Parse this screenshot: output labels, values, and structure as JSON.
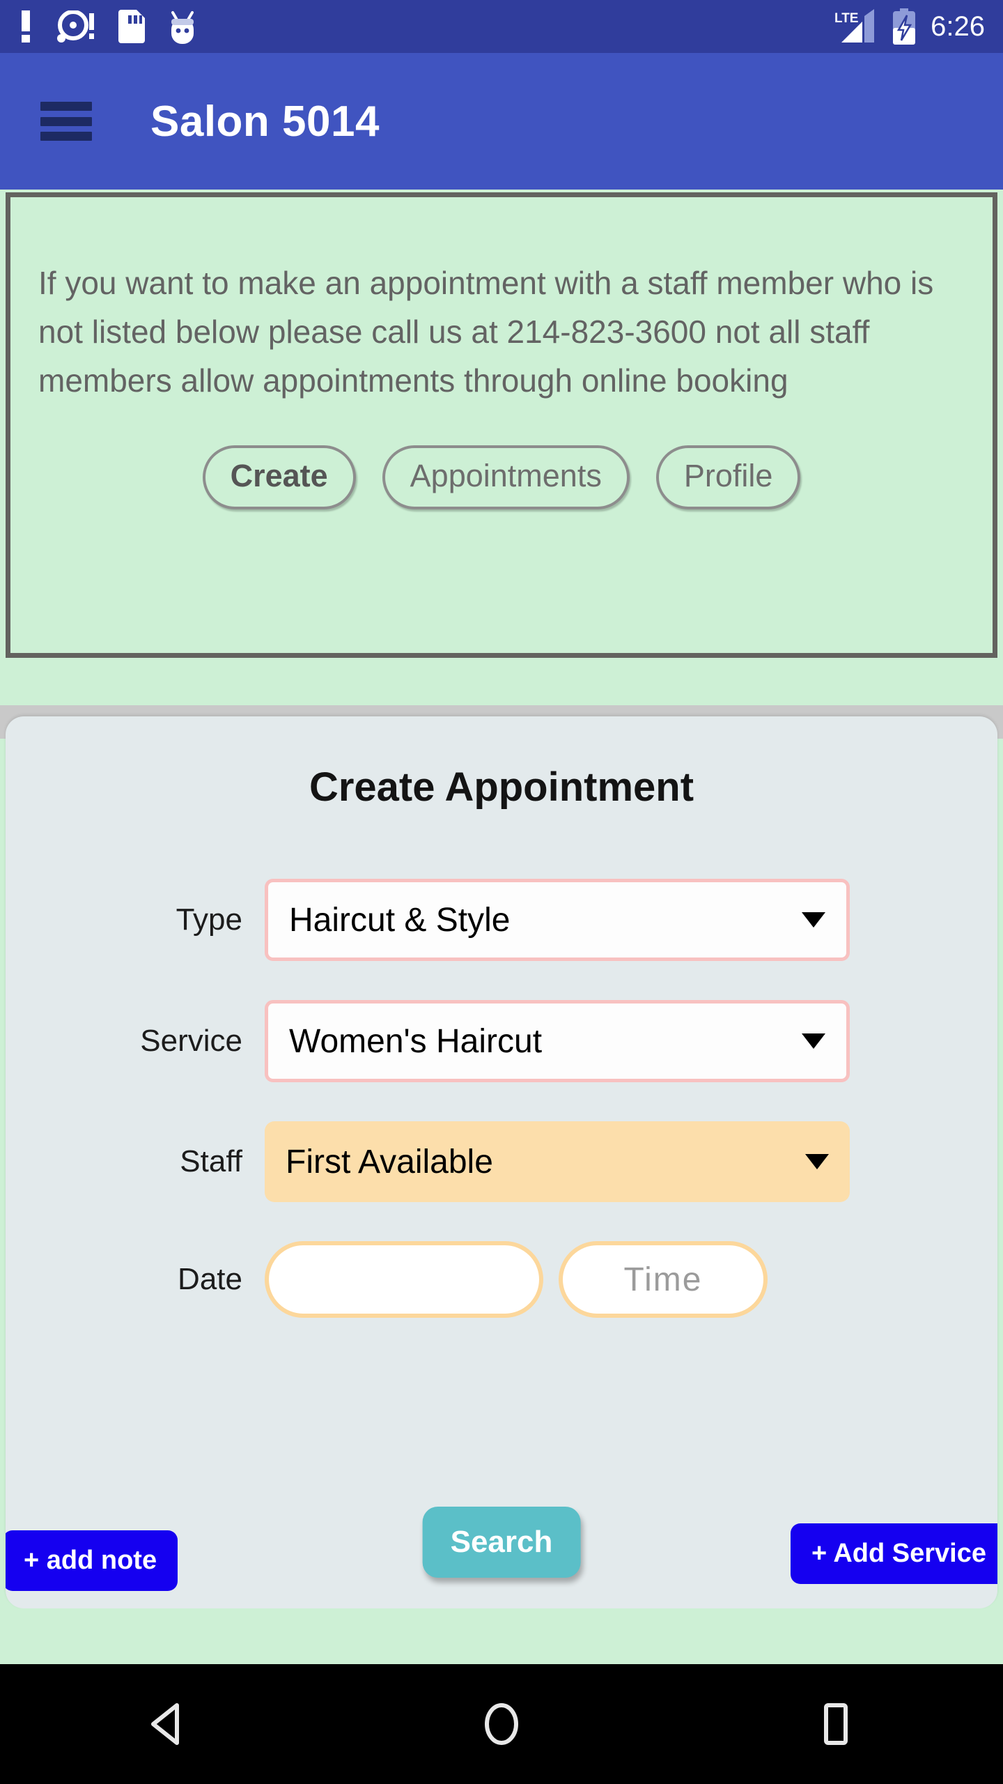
{
  "status_bar": {
    "icons_left": [
      "alert-icon",
      "disc-alert-icon",
      "sim-card-icon",
      "android-head-icon"
    ],
    "network": "LTE",
    "icons_right": [
      "signal-icon",
      "battery-charging-icon"
    ],
    "time": "6:26"
  },
  "app_bar": {
    "menu_icon": "hamburger-menu-icon",
    "title": "Salon 5014"
  },
  "notice": {
    "message": "If you want to make an appointment with a staff member who is not listed below please call us at 214-823-3600 not all staff members allow appointments through online booking",
    "phone": "214-823-3600",
    "tabs": [
      {
        "label": "Create",
        "active": true
      },
      {
        "label": "Appointments",
        "active": false
      },
      {
        "label": "Profile",
        "active": false
      }
    ]
  },
  "form": {
    "title": "Create Appointment",
    "fields": {
      "type": {
        "label": "Type",
        "value": "Haircut & Style"
      },
      "service": {
        "label": "Service",
        "value": "Women's Haircut"
      },
      "staff": {
        "label": "Staff",
        "value": "First Available"
      },
      "date": {
        "label": "Date",
        "value": "",
        "placeholder": ""
      },
      "time": {
        "value": "",
        "placeholder": "Time"
      }
    },
    "buttons": {
      "add_note": "+ add note",
      "search": "Search",
      "add_service": "+ Add Service"
    }
  },
  "nav_bar": {
    "back": "back-triangle-icon",
    "home": "home-circle-icon",
    "recents": "recents-square-icon"
  },
  "colors": {
    "status_bar": "#303d9c",
    "app_bar": "#4054c0",
    "notice_bg": "#cdf0d5",
    "form_bg": "#e3eaec",
    "select_border_pink": "#f8c1c0",
    "staff_peach": "#fcdeab",
    "date_border": "#fcd79b",
    "btn_blue": "#1500f0",
    "btn_teal": "#5bbfc8"
  }
}
